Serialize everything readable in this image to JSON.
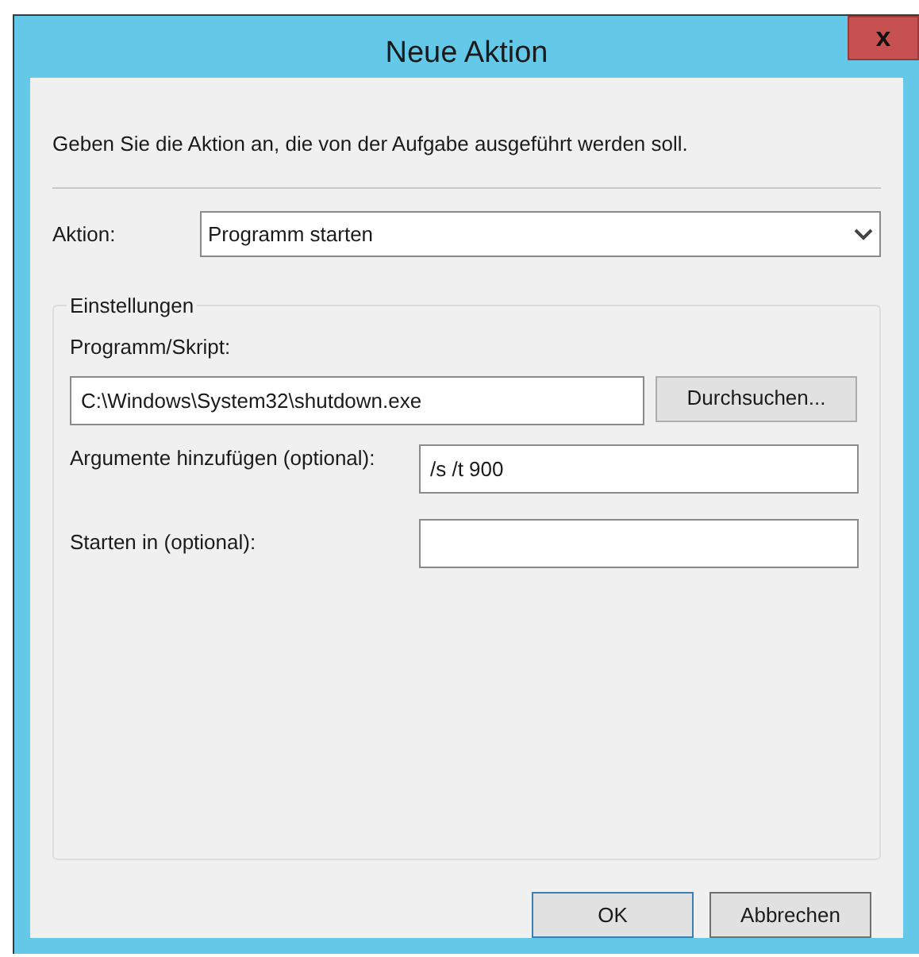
{
  "window": {
    "title": "Neue Aktion",
    "close": "x"
  },
  "instruction": "Geben Sie die Aktion an, die von der Aufgabe ausgeführt werden soll.",
  "action": {
    "label": "Aktion:",
    "value": "Programm starten"
  },
  "settings": {
    "legend": "Einstellungen",
    "program": {
      "label": "Programm/Skript:",
      "value": "C:\\Windows\\System32\\shutdown.exe",
      "browse": "Durchsuchen..."
    },
    "arguments": {
      "label": "Argumente hinzufügen (optional):",
      "value": "/s /t 900"
    },
    "start_in": {
      "label": "Starten in (optional):"
    }
  },
  "buttons": [
    {
      "label": "OK",
      "default": true
    },
    {
      "label": "Abbrechen",
      "default": false
    }
  ]
}
